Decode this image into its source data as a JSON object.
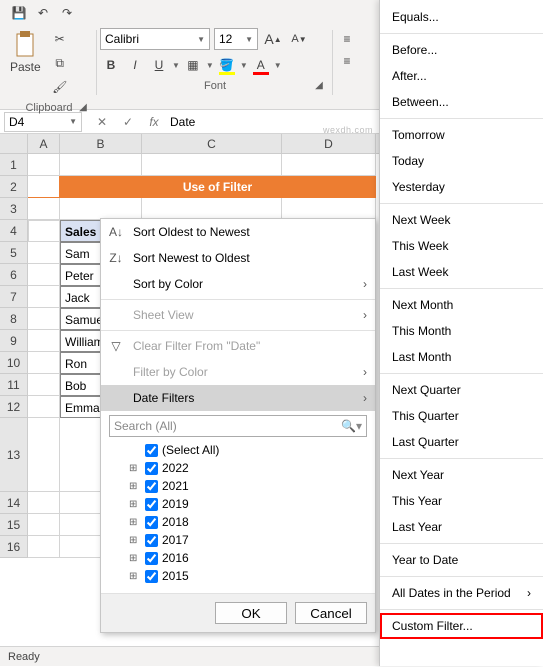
{
  "qa": {
    "save": "💾",
    "undo": "↶",
    "redo": "↷"
  },
  "ribbon": {
    "paste_label": "Paste",
    "clipboard_label": "Clipboard",
    "font_label": "Font",
    "font_name": "Calibri",
    "font_size": "12",
    "bold": "B",
    "italic": "I",
    "underline": "U",
    "incA": "A",
    "decA": "A"
  },
  "namebox": "D4",
  "fx": "fx",
  "formula_value": "Date",
  "cols": {
    "A": "A",
    "B": "B",
    "C": "C",
    "D": "D"
  },
  "rows": [
    "1",
    "2",
    "3",
    "4",
    "5",
    "6",
    "7",
    "8",
    "9",
    "10",
    "11",
    "12",
    "13",
    "14",
    "15",
    "16"
  ],
  "title": "Use of Filter",
  "header": {
    "b": "Sales"
  },
  "data": [
    "Sam",
    "Peter",
    "Jack",
    "Samuel",
    "William",
    "Ron",
    "Bob",
    "Emma"
  ],
  "ctx": {
    "sort_old": "Sort Oldest to Newest",
    "sort_new": "Sort Newest to Oldest",
    "sort_color": "Sort by Color",
    "sheet_view": "Sheet View",
    "clear": "Clear Filter From \"Date\"",
    "filter_color": "Filter by Color",
    "date_filters": "Date Filters",
    "search_ph": "Search (All)",
    "select_all": "(Select All)",
    "years": [
      "2022",
      "2021",
      "2019",
      "2018",
      "2017",
      "2016",
      "2015"
    ],
    "ok": "OK",
    "cancel": "Cancel"
  },
  "sub": {
    "equals": "Equals...",
    "before": "Before...",
    "after": "After...",
    "between": "Between...",
    "tomorrow": "Tomorrow",
    "today": "Today",
    "yesterday": "Yesterday",
    "next_week": "Next Week",
    "this_week": "This Week",
    "last_week": "Last Week",
    "next_month": "Next Month",
    "this_month": "This Month",
    "last_month": "Last Month",
    "next_quarter": "Next Quarter",
    "this_quarter": "This Quarter",
    "last_quarter": "Last Quarter",
    "next_year": "Next Year",
    "this_year": "This Year",
    "last_year": "Last Year",
    "ytd": "Year to Date",
    "all_period": "All Dates in the Period",
    "custom": "Custom Filter..."
  },
  "status": "Ready",
  "watermark": "wexdh.com"
}
